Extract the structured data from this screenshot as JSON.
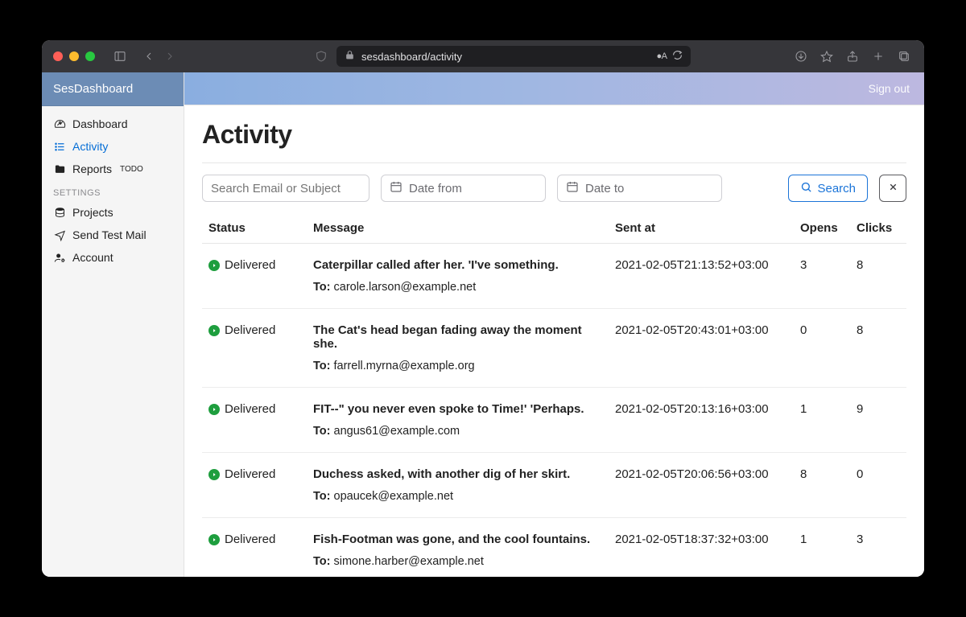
{
  "browser": {
    "url": "sesdashboard/activity"
  },
  "brand": "SesDashboard",
  "topbar": {
    "signout": "Sign out"
  },
  "nav": {
    "items": [
      {
        "label": "Dashboard"
      },
      {
        "label": "Activity"
      },
      {
        "label": "Reports",
        "badge": "TODO"
      }
    ],
    "settings_heading": "SETTINGS",
    "settings": [
      {
        "label": "Projects"
      },
      {
        "label": "Send Test Mail"
      },
      {
        "label": "Account"
      }
    ]
  },
  "page": {
    "title": "Activity",
    "filters": {
      "search_placeholder": "Search Email or Subject",
      "date_from_placeholder": "Date from",
      "date_to_placeholder": "Date to",
      "search_button": "Search"
    },
    "columns": {
      "status": "Status",
      "message": "Message",
      "sent_at": "Sent at",
      "opens": "Opens",
      "clicks": "Clicks"
    },
    "to_label": "To:",
    "rows": [
      {
        "status": "Delivered",
        "subject": "Caterpillar called after her. 'I've something.",
        "to": "carole.larson@example.net",
        "sent_at": "2021-02-05T21:13:52+03:00",
        "opens": "3",
        "clicks": "8"
      },
      {
        "status": "Delivered",
        "subject": "The Cat's head began fading away the moment she.",
        "to": "farrell.myrna@example.org",
        "sent_at": "2021-02-05T20:43:01+03:00",
        "opens": "0",
        "clicks": "8"
      },
      {
        "status": "Delivered",
        "subject": "FIT--\" you never even spoke to Time!' 'Perhaps.",
        "to": "angus61@example.com",
        "sent_at": "2021-02-05T20:13:16+03:00",
        "opens": "1",
        "clicks": "9"
      },
      {
        "status": "Delivered",
        "subject": "Duchess asked, with another dig of her skirt.",
        "to": "opaucek@example.net",
        "sent_at": "2021-02-05T20:06:56+03:00",
        "opens": "8",
        "clicks": "0"
      },
      {
        "status": "Delivered",
        "subject": "Fish-Footman was gone, and the cool fountains.",
        "to": "simone.harber@example.net",
        "sent_at": "2021-02-05T18:37:32+03:00",
        "opens": "1",
        "clicks": "3"
      }
    ]
  }
}
